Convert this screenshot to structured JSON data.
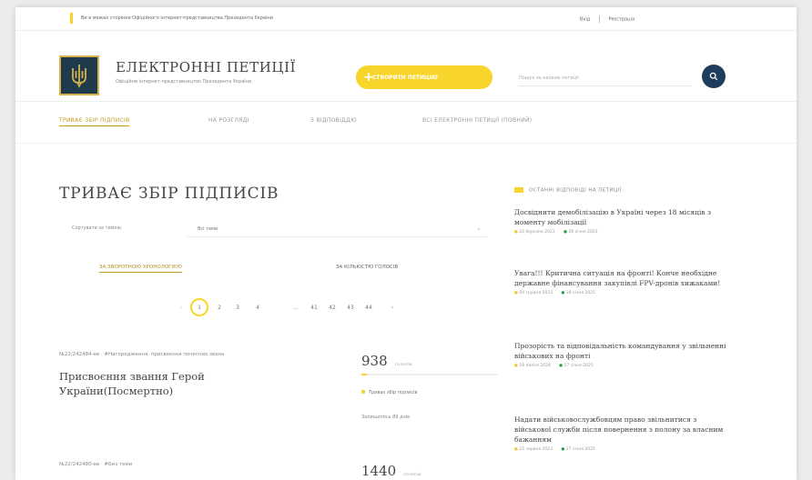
{
  "topbar": {
    "note": "Ви в межах сторінки Офіційного інтернет-представництва Президента України",
    "login": "Вхід",
    "register": "Реєстрація"
  },
  "header": {
    "title": "ЕЛЕКТРОННІ ПЕТИЦІЇ",
    "subtitle": "Офіційне інтернет-представництво Президента України",
    "create_button": "СТВОРИТИ ПЕТИЦІЮ",
    "search_placeholder": "Пошук за назвою петиції"
  },
  "nav": {
    "tabs": [
      "ТРИВАЄ ЗБІР ПІДПИСІВ",
      "НА РОЗГЛЯДІ",
      "З ВІДПОВІДДЮ",
      "ВСІ ЕЛЕКТРОННІ ПЕТИЦІЇ (ПОВНИЙ)"
    ]
  },
  "main": {
    "title": "ТРИВАЄ ЗБІР ПІДПИСІВ",
    "sort_label": "Сортувати за темою:",
    "sort_value": "Всі теми",
    "sort_options": [
      "ЗА ЗВОРОТНОЮ ХРОНОЛОГІЄЮ",
      "ЗА КІЛЬКІСТЮ ГОЛОСІВ"
    ],
    "pagination": [
      "1",
      "2",
      "3",
      "4",
      "…",
      "41",
      "42",
      "43",
      "44",
      "›"
    ]
  },
  "petitions": [
    {
      "meta": "№22/242484-ев · #Нагородження, присвоєння почесних звань",
      "title": "Присвоєння звання Герой України(Посмертно)",
      "votes": "938",
      "votes_unit": "голосів",
      "progress_fraction": 0.04,
      "status": "Триває збір підписів",
      "days_left": "Залишилось 89 днів"
    },
    {
      "meta": "№22/242480-ев · #Без теми",
      "title": "",
      "votes": "1440",
      "votes_unit": "голосів",
      "progress_fraction": 0.06,
      "status": "",
      "days_left": ""
    }
  ],
  "sidebar": {
    "heading": "ОСТАННІ ВІДПОВІДІ НА ПЕТИЦІЇ",
    "answers": [
      {
        "title": "Досвіднити демобілізацію в Україні через 18 місяців з моменту мобілізації",
        "date_yellow": "22 березня 2023",
        "date_green": "28 січня 2025"
      },
      {
        "title": "Увага!!! Критична ситуація на фронті! Конче необхідне державне фінансування закупівлі FPV-дронів хижаками!",
        "date_yellow": "04 грудня 2023",
        "date_green": "28 січня 2025"
      },
      {
        "title": "Прозорість та відповідальність командування у звільненні військових на фронті",
        "date_yellow": "18 липня 2024",
        "date_green": "27 січня 2025"
      },
      {
        "title": "Надати військовослужбовцям право звільнитися з військової служби після повернення з полону за власним бажанням",
        "date_yellow": "22 червня 2023",
        "date_green": "27 січня 2025"
      }
    ]
  },
  "colors": {
    "accent_yellow": "#f7d52b",
    "navy": "#1e3c5c",
    "green": "#2e9c45"
  }
}
